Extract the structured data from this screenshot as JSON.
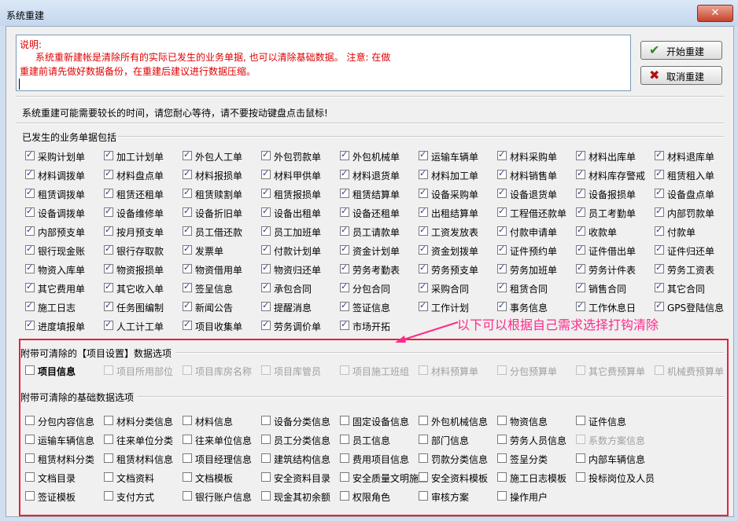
{
  "window": {
    "title": "系统重建",
    "close_glyph": "✕"
  },
  "memo": {
    "line1": "说明:",
    "line2": "系统重新建帐是清除所有的实际已发生的业务单据, 也可以清除基础数据。  注意:   在做",
    "line3": "重建前请先做好数据备份，在重建后建议进行数据压缩。"
  },
  "buttons": {
    "start": {
      "label": "开始重建",
      "icon": "check-icon",
      "color": "#2e8b1e"
    },
    "cancel": {
      "label": "取消重建",
      "icon": "x-icon",
      "color": "#b01010"
    }
  },
  "note": "系统重建可能需要较长的时间，请您耐心等待，请不要按动键盘点击鼠标!",
  "business": {
    "title": "已发生的业务单据包括",
    "items": [
      "采购计划单",
      "加工计划单",
      "外包人工单",
      "外包罚款单",
      "外包机械单",
      "运输车辆单",
      "材料采购单",
      "材料出库单",
      "材料退库单",
      "材料调拨单",
      "材料盘点单",
      "材料报损单",
      "材料甲供单",
      "材料退货单",
      "材料加工单",
      "材料销售单",
      "材料库存警戒",
      "租赁租入单",
      "租赁调拨单",
      "租赁还租单",
      "租赁赎割单",
      "租赁报损单",
      "租赁结算单",
      "设备采购单",
      "设备退货单",
      "设备报损单",
      "设备盘点单",
      "设备调拨单",
      "设备维修单",
      "设备折旧单",
      "设备出租单",
      "设备还租单",
      "出租结算单",
      "工程借还款单",
      "员工考勤单",
      "内部罚款单",
      "内部预支单",
      "按月预支单",
      "员工借还款",
      "员工加班单",
      "员工请款单",
      "工资发放表",
      "付款申请单",
      "收款单",
      "付款单",
      "银行现金账",
      "银行存取款",
      "发票单",
      "付款计划单",
      "资金计划单",
      "资金划拨单",
      "证件预约单",
      "证件借出单",
      "证件归还单",
      "物资入库单",
      "物资报损单",
      "物资借用单",
      "物资归还单",
      "劳务考勤表",
      "劳务预支单",
      "劳务加班单",
      "劳务计件表",
      "劳务工资表",
      "其它费用单",
      "其它收入单",
      "签呈信息",
      "承包合同",
      "分包合同",
      "采购合同",
      "租赁合同",
      "销售合同",
      "其它合同",
      "施工日志",
      "任务图编制",
      "新闻公告",
      "提醒消息",
      "签证信息",
      "工作计划",
      "事务信息",
      "工作休息日",
      "GPS登陆信息",
      "进度填报单",
      "人工计工单",
      "项目收集单",
      "劳务调价单",
      "市场开拓"
    ]
  },
  "annotation": "以下可以根据自己需求选择打钩清除",
  "project": {
    "title": "附带可清除的【项目设置】数据选项",
    "items": [
      "项目信息",
      "项目所用部位",
      "项目库房名称",
      "项目库管员",
      "项目施工班组",
      "材料预算单",
      "分包预算单",
      "其它费预算单",
      "机械费预算单"
    ]
  },
  "basic": {
    "title": "附带可清除的基础数据选项",
    "items": [
      "分包内容信息",
      "材料分类信息",
      "材料信息",
      "设备分类信息",
      "固定设备信息",
      "外包机械信息",
      "物资信息",
      "证件信息",
      "运输车辆信息",
      "往来单位分类",
      "往来单位信息",
      "员工分类信息",
      "员工信息",
      "部门信息",
      "劳务人员信息",
      "系数方案信息",
      "租赁材料分类",
      "租赁材料信息",
      "项目经理信息",
      "建筑结构信息",
      "费用项目信息",
      "罚款分类信息",
      "签呈分类",
      "内部车辆信息",
      "文档目录",
      "文档资料",
      "文档模板",
      "安全资料目录",
      "安全质量文明施工",
      "安全资料模板",
      "施工日志模板",
      "投标岗位及人员",
      "签证模板",
      "支付方式",
      "银行账户信息",
      "现金其初余额",
      "权限角色",
      "审核方案",
      "操作用户"
    ]
  }
}
